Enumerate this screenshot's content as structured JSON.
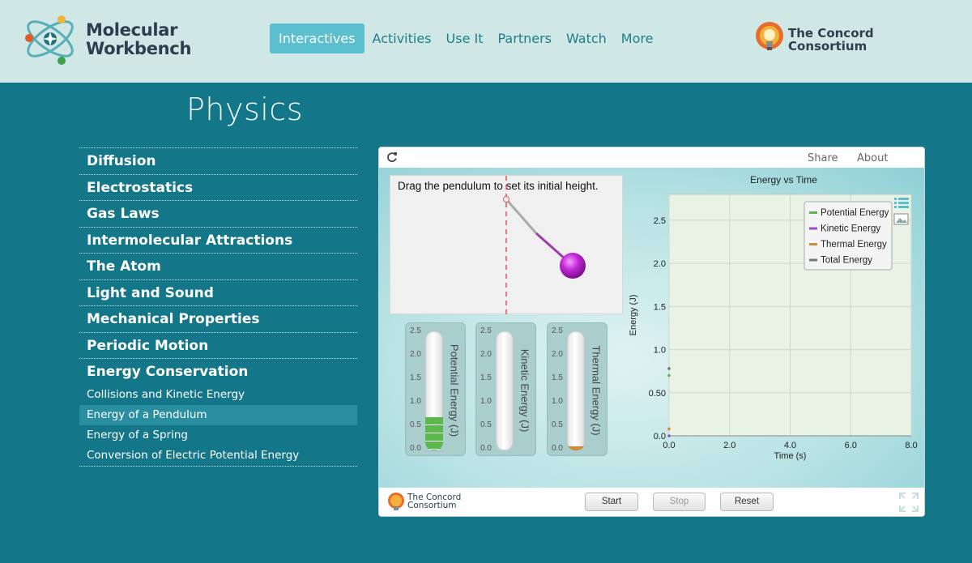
{
  "header": {
    "logo_line1": "Molecular",
    "logo_line2": "Workbench",
    "nav": [
      {
        "label": "Interactives",
        "active": true
      },
      {
        "label": "Activities"
      },
      {
        "label": "Use It"
      },
      {
        "label": "Partners"
      },
      {
        "label": "Watch"
      },
      {
        "label": "More"
      }
    ],
    "partner_line1": "The Concord",
    "partner_line2": "Consortium"
  },
  "page_title": "Physics",
  "sidebar": {
    "items": [
      "Diffusion",
      "Electrostatics",
      "Gas Laws",
      "Intermolecular Attractions",
      "The Atom",
      "Light and Sound",
      "Mechanical Properties",
      "Periodic Motion",
      "Energy Conservation"
    ],
    "subitems": [
      {
        "label": "Collisions and Kinetic Energy"
      },
      {
        "label": "Energy of a Pendulum",
        "active": true
      },
      {
        "label": "Energy of a Spring"
      },
      {
        "label": "Conversion of Electric Potential Energy"
      }
    ]
  },
  "sim": {
    "share_label": "Share",
    "about_label": "About",
    "pendulum_caption": "Drag the pendulum to set its initial height.",
    "bars": [
      {
        "label": "Potential Energy (J)",
        "value": 0.7,
        "color": "#5cb84a"
      },
      {
        "label": "Kinetic Energy (J)",
        "value": 0.0,
        "color": "#9b4dca"
      },
      {
        "label": "Thermal Energy (J)",
        "value": 0.05,
        "color": "#d08a3c"
      }
    ],
    "bar_ticks": [
      "2.5",
      "2.0",
      "1.5",
      "1.0",
      "0.5",
      "0.0"
    ],
    "bar_max": 2.5,
    "buttons": {
      "start": "Start",
      "stop": "Stop",
      "reset": "Reset"
    },
    "footer_line1": "The Concord",
    "footer_line2": "Consortium"
  },
  "chart_data": {
    "type": "line",
    "title": "Energy vs Time",
    "xlabel": "Time (s)",
    "ylabel": "Energy (J)",
    "xlim": [
      0,
      8
    ],
    "ylim": [
      0,
      2.8
    ],
    "x_ticks": [
      "0.0",
      "2.0",
      "4.0",
      "6.0",
      "8.0"
    ],
    "x_tick_values": [
      0,
      2,
      4,
      6,
      8
    ],
    "y_ticks": [
      "0.0",
      "0.50",
      "1.0",
      "1.5",
      "2.0",
      "2.5"
    ],
    "y_tick_values": [
      0,
      0.5,
      1.0,
      1.5,
      2.0,
      2.5
    ],
    "grid": true,
    "legend_position": "top-right",
    "series": [
      {
        "name": "Potential Energy",
        "color": "#5cb84a",
        "x": [
          0
        ],
        "y": [
          0.7
        ]
      },
      {
        "name": "Kinetic Energy",
        "color": "#9b4dca",
        "x": [
          0
        ],
        "y": [
          0.0
        ]
      },
      {
        "name": "Thermal Energy",
        "color": "#d08a3c",
        "x": [
          0
        ],
        "y": [
          0.08
        ]
      },
      {
        "name": "Total Energy",
        "color": "#777777",
        "x": [
          0
        ],
        "y": [
          0.78
        ]
      }
    ]
  }
}
